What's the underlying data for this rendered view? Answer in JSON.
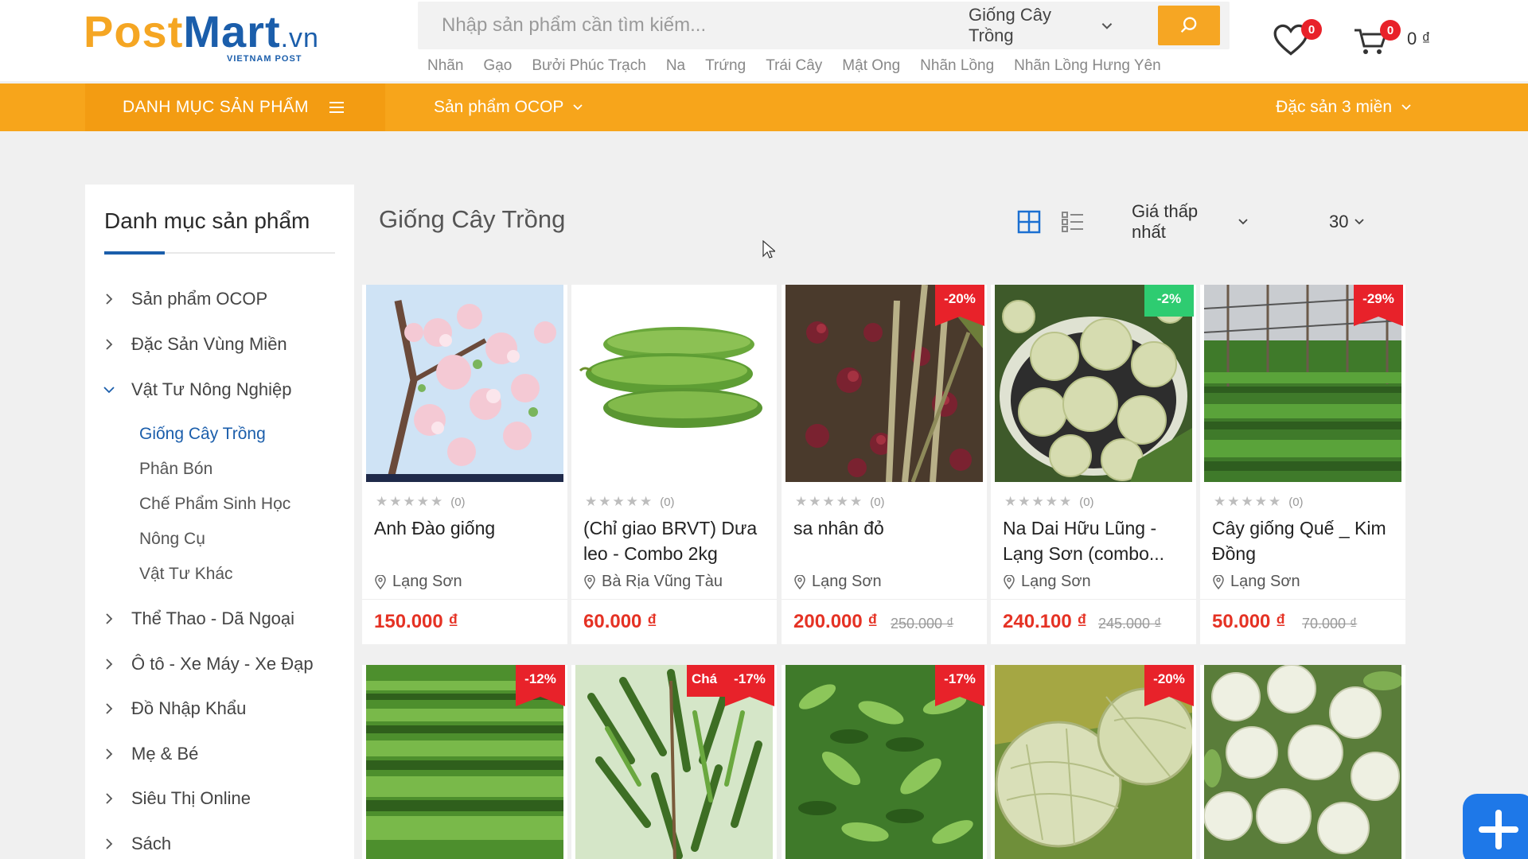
{
  "brand": {
    "logo_part1": "Post",
    "logo_part2": "Mart",
    "logo_domain": ".vn",
    "logo_tagline": "VIETNAM POST"
  },
  "search": {
    "placeholder": "Nhập sản phẩm cần tìm kiếm...",
    "category": "Giống Cây Trồng"
  },
  "wishlist": {
    "count": "0"
  },
  "cart": {
    "count": "0",
    "total": "0 ₫"
  },
  "suggestions": [
    "Nhãn",
    "Gạo",
    "Bưởi Phúc Trạch",
    "Na",
    "Trứng",
    "Trái Cây",
    "Mật Ong",
    "Nhãn Lồng",
    "Nhãn Lồng Hưng Yên"
  ],
  "nav": {
    "categories": "DANH MỤC SẢN PHẨM",
    "ocop": "Sản phẩm OCOP",
    "regional": "Đặc sản 3 miền"
  },
  "sidebar": {
    "title": "Danh mục sản phẩm",
    "items": [
      {
        "label": "Sản phẩm OCOP"
      },
      {
        "label": "Đặc Sản Vùng Miền"
      },
      {
        "label": "Vật Tư Nông Nghiệp"
      },
      {
        "label": "Thể Thao - Dã Ngoại"
      },
      {
        "label": "Ô tô - Xe Máy - Xe Đạp"
      },
      {
        "label": "Đồ Nhập Khẩu"
      },
      {
        "label": "Mẹ & Bé"
      },
      {
        "label": "Siêu Thị Online"
      },
      {
        "label": "Sách"
      }
    ],
    "subitems": [
      {
        "label": "Giống Cây Trồng"
      },
      {
        "label": "Phân Bón"
      },
      {
        "label": "Chế Phẩm Sinh Học"
      },
      {
        "label": "Nông Cụ"
      },
      {
        "label": "Vật Tư Khác"
      }
    ]
  },
  "main": {
    "title": "Giống Cây Trồng",
    "sort": "Giá thấp nhất",
    "per_page": "30"
  },
  "products": [
    {
      "name": "Anh Đào giống",
      "reviews": "(0)",
      "location": "Lạng Sơn",
      "price": "150.000 ₫",
      "old_price": "",
      "discount": ""
    },
    {
      "name": "(Chỉ giao BRVT) Dưa leo - Combo 2kg",
      "reviews": "(0)",
      "location": "Bà Rịa Vũng Tàu",
      "price": "60.000 ₫",
      "old_price": "",
      "discount": ""
    },
    {
      "name": "sa nhân đỏ",
      "reviews": "(0)",
      "location": "Lạng Sơn",
      "price": "200.000 ₫",
      "old_price": "250.000 ₫",
      "discount": "-20%"
    },
    {
      "name": "Na Dai Hữu Lũng - Lạng Sơn (combo...",
      "reviews": "(0)",
      "location": "Lạng Sơn",
      "price": "240.100 ₫",
      "old_price": "245.000 ₫",
      "discount": "-2%"
    },
    {
      "name": "Cây giống Quế _ Kim Đồng",
      "reviews": "(0)",
      "location": "Lạng Sơn",
      "price": "50.000 ₫",
      "old_price": "70.000 ₫",
      "discount": "-29%"
    }
  ],
  "products_row2": [
    {
      "discount": "-12%"
    },
    {
      "discount": "-17%",
      "tag": "Chá"
    },
    {
      "discount": "-17%"
    },
    {
      "discount": "-20%"
    },
    {
      "discount": ""
    }
  ],
  "colors": {
    "accent": "#f7a51b",
    "brand_blue": "#1b5eab",
    "price_red": "#e53224",
    "sale_red": "#e8222a",
    "sale_green": "#2ecc71"
  }
}
